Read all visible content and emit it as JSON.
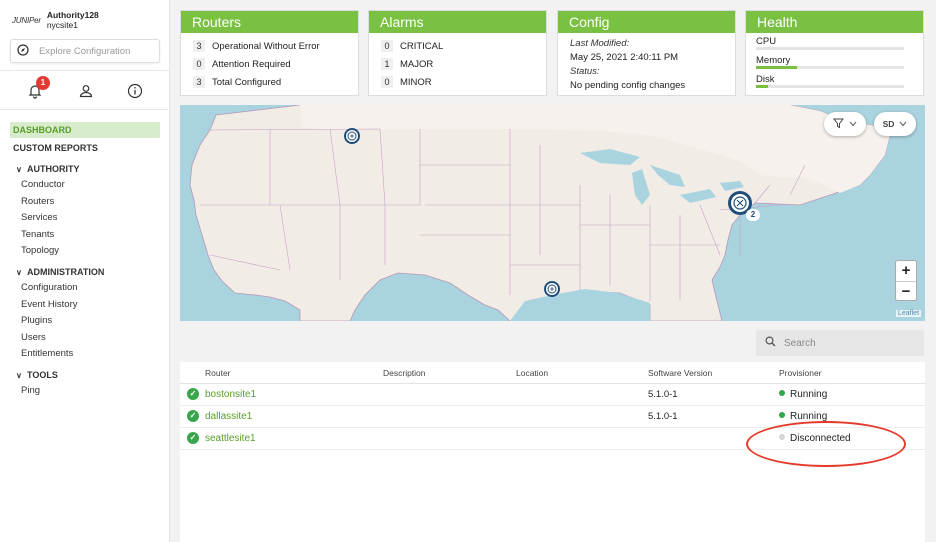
{
  "brand": {
    "logo": "JUNIPer",
    "title": "Authority128",
    "subtitle": "nycsite1"
  },
  "explore": {
    "placeholder": "Explore Configuration",
    "icon": "compass-icon"
  },
  "toolbar": {
    "notifications_count": "1"
  },
  "nav": {
    "dashboard": "DASHBOARD",
    "custom_reports": "CUSTOM REPORTS",
    "authority": {
      "label": "AUTHORITY",
      "items": [
        "Conductor",
        "Routers",
        "Services",
        "Tenants",
        "Topology"
      ]
    },
    "administration": {
      "label": "ADMINISTRATION",
      "items": [
        "Configuration",
        "Event History",
        "Plugins",
        "Users",
        "Entitlements"
      ]
    },
    "tools": {
      "label": "TOOLS",
      "items": [
        "Ping"
      ]
    }
  },
  "routers_card": {
    "title": "Routers",
    "rows": [
      {
        "num": "3",
        "label": "Operational Without Error"
      },
      {
        "num": "0",
        "label": "Attention Required"
      },
      {
        "num": "3",
        "label": "Total Configured"
      }
    ]
  },
  "alarms_card": {
    "title": "Alarms",
    "rows": [
      {
        "num": "0",
        "label": "CRITICAL"
      },
      {
        "num": "1",
        "label": "MAJOR"
      },
      {
        "num": "0",
        "label": "MINOR"
      }
    ]
  },
  "config_card": {
    "title": "Config",
    "modified_label": "Last Modified:",
    "modified_value": "May 25, 2021 2:40:11 PM",
    "status_label": "Status:",
    "status_value": "No pending config changes"
  },
  "health_card": {
    "title": "Health",
    "metrics": [
      {
        "label": "CPU",
        "level": 0.0
      },
      {
        "label": "Memory",
        "level": 0.28
      },
      {
        "label": "Disk",
        "level": 0.08
      }
    ]
  },
  "map": {
    "filter_icon": "filter-icon",
    "size_label": "SD",
    "zoom_in": "+",
    "zoom_out": "−",
    "attribution": "Leaflet",
    "cluster_count": "2"
  },
  "search": {
    "placeholder": "Search"
  },
  "table": {
    "headers": [
      "Router",
      "Description",
      "Location",
      "Software Version",
      "Provisioner"
    ],
    "rows": [
      {
        "router": "bostonsite1",
        "version": "5.1.0-1",
        "status": "Running",
        "status_color": "#2ea84a"
      },
      {
        "router": "dallassite1",
        "version": "5.1.0-1",
        "status": "Running",
        "status_color": "#2ea84a"
      },
      {
        "router": "seattlesite1",
        "version": "",
        "status": "Disconnected",
        "status_color": "#d6d6d6"
      }
    ]
  },
  "colors": {
    "accent": "#7ac143",
    "nav_active_bg": "#d6eccb",
    "link": "#5a9e29",
    "annotation": "#e53a2a"
  }
}
